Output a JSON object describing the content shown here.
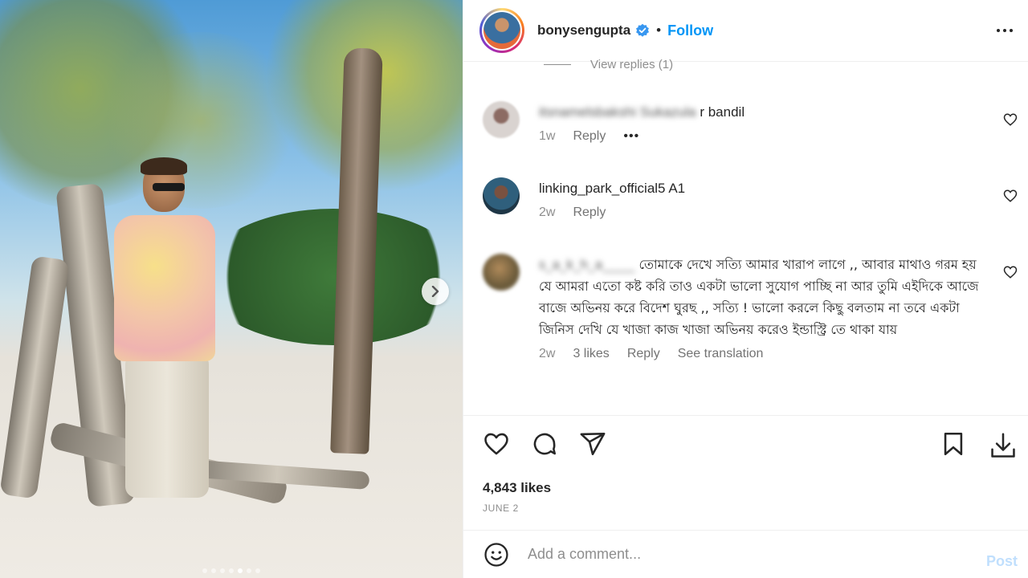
{
  "post": {
    "username": "bonysengupta",
    "follow_label": "Follow",
    "separator": "•",
    "likes": "4,843 likes",
    "date": "JUNE 2",
    "carousel": {
      "slide_count": 7,
      "active_slide": 5
    }
  },
  "view_replies": "View replies (1)",
  "comments": [
    {
      "username_blurred": "itsnamelsbakshi Sukazula",
      "text": "r bandil",
      "time": "1w",
      "reply_label": "Reply",
      "more_label": "•••"
    },
    {
      "username": "linking_park_official5",
      "text": "A1",
      "time": "2w",
      "reply_label": "Reply"
    },
    {
      "username_blurred": "s_a_k_h_a_____",
      "text": "তোমাকে দেখে সত্যি আমার খারাপ লাগে ,, আবার মাথাও গরম হয় যে আমরা এতো কষ্ট করি তাও একটা ভালো সুযোগ পাচ্ছি না আর তুমি এইদিকে আজে বাজে অভিনয় করে বিদেশ ঘুরছ ,, সত্যি ! ভালো করলে কিছু বলতাম না তবে একটা জিনিস দেখি যে খাজা কাজ খাজা অভিনয় করেও ইন্ডাস্ট্রি তে থাকা যায়",
      "time": "2w",
      "likes": "3 likes",
      "reply_label": "Reply",
      "translate_label": "See translation"
    }
  ],
  "comment_box": {
    "placeholder": "Add a comment...",
    "post_label": "Post"
  },
  "colors": {
    "accent": "#0095f6",
    "verified": "#3897f0",
    "post_disabled": "#c0dffd"
  }
}
